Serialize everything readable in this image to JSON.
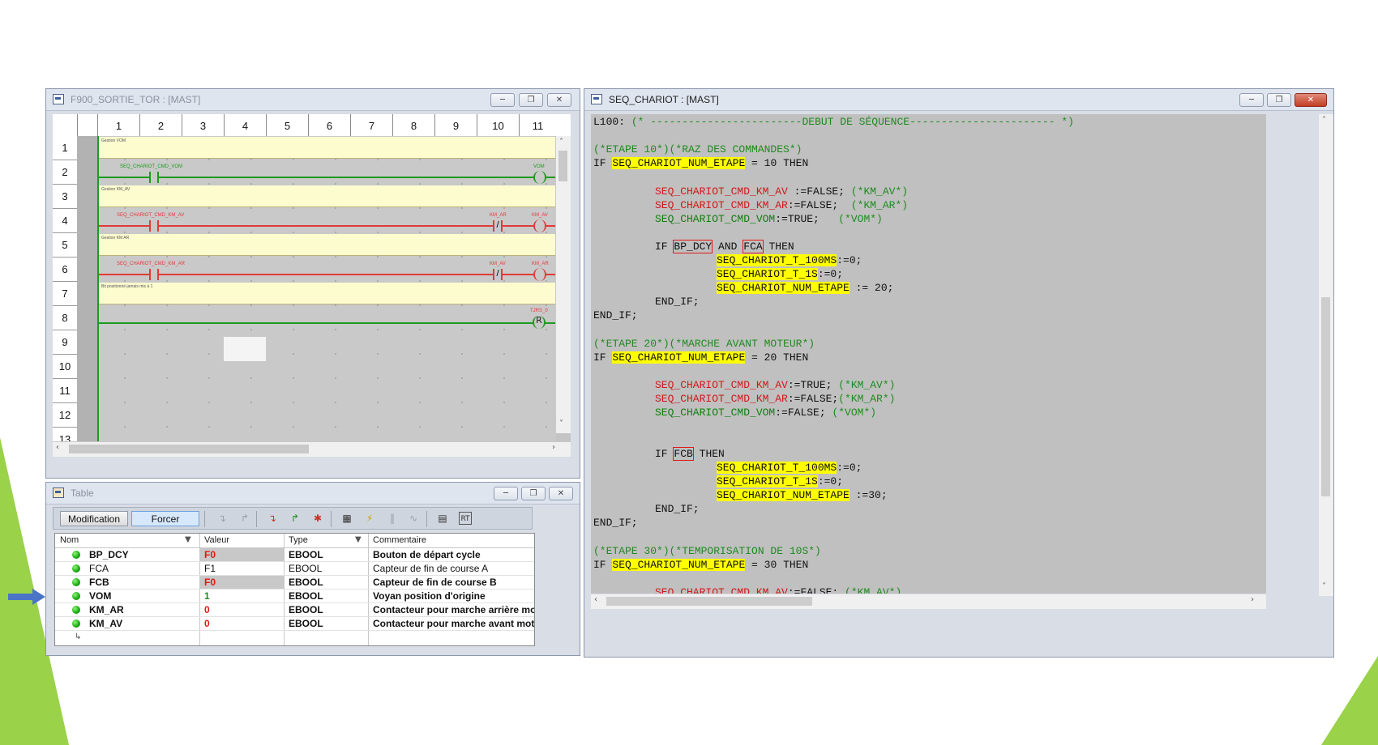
{
  "ladder_window": {
    "title": "F900_SORTIE_TOR : [MAST]",
    "columns": [
      "1",
      "2",
      "3",
      "4",
      "5",
      "6",
      "7",
      "8",
      "9",
      "10",
      "11"
    ],
    "rows": [
      "1",
      "2",
      "3",
      "4",
      "5",
      "6",
      "7",
      "8",
      "9",
      "10",
      "11",
      "12",
      "13"
    ],
    "comments": {
      "r1": "Gestion VOM",
      "r3": "Gestion KM_AV",
      "r5": "Gestion KM AR",
      "r7": "Bit positionné jamais mis à 1"
    },
    "labels": {
      "r2_contact": "SEQ_CHARIOT_CMD_VOM",
      "r2_coil": "VOM",
      "r4_contact": "SEQ_CHARIOT_CMD_KM_AV",
      "r4_mid": "KM_AR",
      "r4_coil": "KM_AV",
      "r6_contact": "SEQ_CHARIOT_CMD_KM_AR",
      "r6_mid": "KM_AV",
      "r6_coil": "KM_AR",
      "r8_coil_label": "TJRS_0",
      "r8_coil_letter": "R",
      "neg_mark": "/"
    }
  },
  "table_window": {
    "title": "Table",
    "toolbar": {
      "modification": "Modification",
      "forcer": "Forcer"
    },
    "headers": {
      "nom": "Nom",
      "valeur": "Valeur",
      "type": "Type",
      "commentaire": "Commentaire"
    },
    "rows": [
      {
        "nom": "BP_DCY",
        "valeur": "F0",
        "type": "EBOOL",
        "commentaire": "Bouton de départ cycle"
      },
      {
        "nom": "FCA",
        "valeur": "F1",
        "type": "EBOOL",
        "commentaire": "Capteur de fin de course A"
      },
      {
        "nom": "FCB",
        "valeur": "F0",
        "type": "EBOOL",
        "commentaire": "Capteur de fin de course B"
      },
      {
        "nom": "VOM",
        "valeur": "1",
        "type": "EBOOL",
        "commentaire": "Voyan position d'origine"
      },
      {
        "nom": "KM_AR",
        "valeur": "0",
        "type": "EBOOL",
        "commentaire": "Contacteur pour marche arrière mo..."
      },
      {
        "nom": "KM_AV",
        "valeur": "0",
        "type": "EBOOL",
        "commentaire": "Contacteur pour marche avant mot..."
      }
    ]
  },
  "code_window": {
    "title": "SEQ_CHARIOT : [MAST]",
    "tokens": {
      "label": "L100:",
      "header_comment": "(* ------------------------DEBUT DE SÉQUENCE----------------------- *)",
      "c_etape10": "(*ETAPE 10*)(*RAZ DES COMMANDES*)",
      "c_etape20": "(*ETAPE 20*)(*MARCHE AVANT MOTEUR*)",
      "c_etape30": "(*ETAPE 30*)(*TEMPORISATION DE 10S*)",
      "if": "IF",
      "then": "THEN",
      "and": "AND",
      "end_if": "END_IF;",
      "num_etape": "SEQ_CHARIOT_NUM_ETAPE",
      "km_av": "SEQ_CHARIOT_CMD_KM_AV",
      "km_ar": "SEQ_CHARIOT_CMD_KM_AR",
      "vom": "SEQ_CHARIOT_CMD_VOM",
      "t100": "SEQ_CHARIOT_T_100MS",
      "t1s": "SEQ_CHARIOT_T_1S",
      "bp_dcy": "BP_DCY",
      "fca": "FCA",
      "fcb": "FCB",
      "eq10": " = 10 ",
      "eq20": " = 20 ",
      "eq30": " = 30 ",
      "a1": " :=FALSE; ",
      "a2": ":=FALSE;  ",
      "a3": ":=TRUE;   ",
      "a4": ":=TRUE; ",
      "a5": ":=FALSE; ",
      "a6": ":=FALSE;",
      "z": ":=0;",
      "set20": " := 20;",
      "set30": " :=30;",
      "c_kmav": "(*KM_AV*)",
      "c_kmar": "(*KM_AR*)",
      "c_vom": "(*VOM*)"
    }
  },
  "colors": {
    "accent_blue": "#4a74c7",
    "triangle_green": "#9ad24a",
    "highlight": "#ffff00",
    "var_red": "#d11818",
    "comment_green": "#1f8a1f"
  }
}
